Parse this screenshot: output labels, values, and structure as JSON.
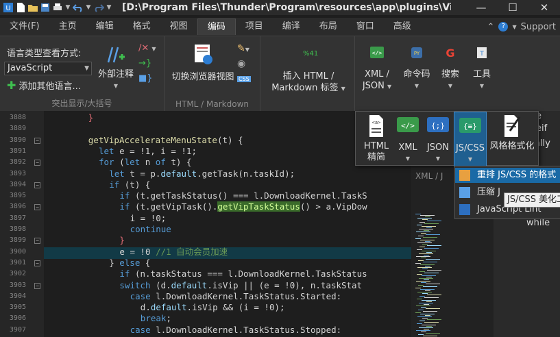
{
  "title": "[D:\\Program Files\\Thunder\\Program\\resources\\app\\plugins\\Vip",
  "menu": {
    "items": [
      "文件(F)",
      "主页",
      "编辑",
      "格式",
      "视图",
      "编码",
      "项目",
      "编译",
      "布局",
      "窗口",
      "高级"
    ],
    "active_index": 5,
    "help_label": "?",
    "support_label": "Support"
  },
  "ribbon": {
    "lang_view_label": "语言类型查看方式:",
    "lang_select_value": "JavaScript",
    "add_lang_label": "添加其他语言...",
    "ext_comment_label": "外部注释",
    "group1_label": "突出显示/大括号",
    "switch_view_label": "切换浏览器视图",
    "group2_label": "HTML / Markdown",
    "percent_label": "%41",
    "insert_html_label": "插入 HTML /",
    "markdown_tag_label": "Markdown 标签",
    "xml_label": "XML /",
    "json_label": "JSON",
    "cmd_code_label": "命令码",
    "search_label": "搜索",
    "tools_label": "工具",
    "css_tag": "CSS"
  },
  "dropdown": {
    "html_label": "HTML",
    "html_label2": "精简",
    "xml_label": "XML",
    "json_label": "JSON",
    "jscss_label": "JS/CSS",
    "style_label": "风格格式化",
    "group_label": "XML / J"
  },
  "submenu": {
    "items": [
      "重排 JS/CSS 的格式",
      "压缩 J",
      "JavaScript Lint"
    ],
    "active_index": 0
  },
  "tooltip": "JS/CSS 美化工",
  "right_pane_texts": [
    "e",
    "eif",
    "ally",
    "while"
  ],
  "editor": {
    "line_numbers": [
      "3888",
      "3889",
      "3890",
      "3891",
      "3892",
      "3893",
      "3894",
      "3895",
      "3896",
      "3897",
      "3898",
      "3899",
      "3900",
      "3901",
      "3902",
      "3903",
      "3904",
      "3905",
      "3906",
      "3907"
    ],
    "highlight_line": "3900",
    "lines": [
      {
        "indent": 4,
        "tokens": [
          [
            "brace",
            "}"
          ]
        ]
      },
      {
        "indent": 0,
        "tokens": []
      },
      {
        "indent": 4,
        "tokens": [
          [
            "fn",
            "getVipAccelerateMenuState"
          ],
          [
            "pl",
            "(t) {"
          ]
        ]
      },
      {
        "indent": 5,
        "tokens": [
          [
            "kw",
            "let"
          ],
          [
            "pl",
            " e = !1, i = !1;"
          ]
        ]
      },
      {
        "indent": 5,
        "tokens": [
          [
            "kw",
            "for"
          ],
          [
            "pl",
            " ("
          ],
          [
            "kw",
            "let"
          ],
          [
            "pl",
            " n "
          ],
          [
            "kw",
            "of"
          ],
          [
            "pl",
            " t) {"
          ]
        ]
      },
      {
        "indent": 6,
        "tokens": [
          [
            "kw",
            "let"
          ],
          [
            "pl",
            " t = p."
          ],
          [
            "pr",
            "default"
          ],
          [
            "pl",
            ".getTask(n.taskId);"
          ]
        ]
      },
      {
        "indent": 6,
        "tokens": [
          [
            "kw",
            "if"
          ],
          [
            "pl",
            " (t) {"
          ]
        ]
      },
      {
        "indent": 7,
        "tokens": [
          [
            "kw",
            "if"
          ],
          [
            "pl",
            " (t.getTaskStatus() === l.DownloadKernel.TaskS"
          ]
        ]
      },
      {
        "indent": 7,
        "tokens": [
          [
            "kw",
            "if"
          ],
          [
            "pl",
            " (t.getVipTask()."
          ],
          [
            "match",
            "getVipTaskStatus"
          ],
          [
            "pl",
            "() > a.VipDow"
          ]
        ]
      },
      {
        "indent": 8,
        "tokens": [
          [
            "pl",
            "i = !0;"
          ]
        ]
      },
      {
        "indent": 8,
        "tokens": [
          [
            "kw",
            "continue"
          ]
        ]
      },
      {
        "indent": 7,
        "tokens": [
          [
            "brace",
            "}"
          ]
        ]
      },
      {
        "indent": 7,
        "tokens": [
          [
            "pl",
            "e = !0 "
          ],
          [
            "cm",
            "//1 自动会员加速"
          ]
        ]
      },
      {
        "indent": 6,
        "tokens": [
          [
            "pl",
            "} "
          ],
          [
            "kw",
            "else"
          ],
          [
            "pl",
            " {"
          ]
        ]
      },
      {
        "indent": 7,
        "tokens": [
          [
            "kw",
            "if"
          ],
          [
            "pl",
            " (n.taskStatus === l.DownloadKernel.TaskStatus"
          ]
        ]
      },
      {
        "indent": 7,
        "tokens": [
          [
            "kw",
            "switch"
          ],
          [
            "pl",
            " (d."
          ],
          [
            "pr",
            "default"
          ],
          [
            "pl",
            ".isVip || (e = !0), n.taskStat"
          ]
        ]
      },
      {
        "indent": 8,
        "tokens": [
          [
            "kw",
            "case"
          ],
          [
            "pl",
            " l.DownloadKernel.TaskStatus.Started:"
          ]
        ]
      },
      {
        "indent": 9,
        "tokens": [
          [
            "pl",
            "d."
          ],
          [
            "pr",
            "default"
          ],
          [
            "pl",
            ".isVip && (i = !0);"
          ]
        ]
      },
      {
        "indent": 9,
        "tokens": [
          [
            "kw",
            "break"
          ],
          [
            "pl",
            ";"
          ]
        ]
      },
      {
        "indent": 8,
        "tokens": [
          [
            "kw",
            "case"
          ],
          [
            "pl",
            " l.DownloadKernel.TaskStatus.Stopped:"
          ]
        ]
      }
    ]
  },
  "colors": {
    "accent": "#1a6aa6",
    "highlight_row": "#123a46",
    "match_bg": "#3a6b2a"
  }
}
